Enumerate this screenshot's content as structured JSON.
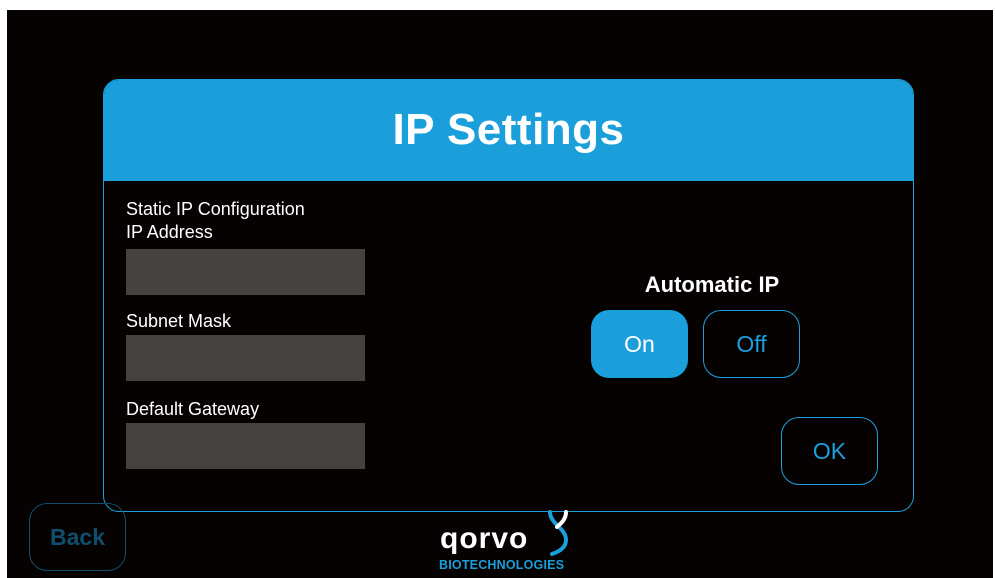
{
  "dialog": {
    "title": "IP Settings",
    "static_ip": {
      "section_label": "Static IP Configuration",
      "ip_address_label": "IP Address",
      "ip_address_value": "",
      "subnet_mask_label": "Subnet Mask",
      "subnet_mask_value": "",
      "default_gateway_label": "Default Gateway",
      "default_gateway_value": ""
    },
    "automatic_ip": {
      "label": "Automatic IP",
      "on_label": "On",
      "off_label": "Off",
      "selected": "On"
    },
    "ok_label": "OK"
  },
  "footer": {
    "back_label": "Back",
    "logo_word": "qorvo",
    "logo_subtitle": "BIOTECHNOLOGIES"
  },
  "colors": {
    "accent": "#1a9fdb",
    "background": "#060202",
    "field": "#464242",
    "disabled": "#0f4e6d"
  }
}
